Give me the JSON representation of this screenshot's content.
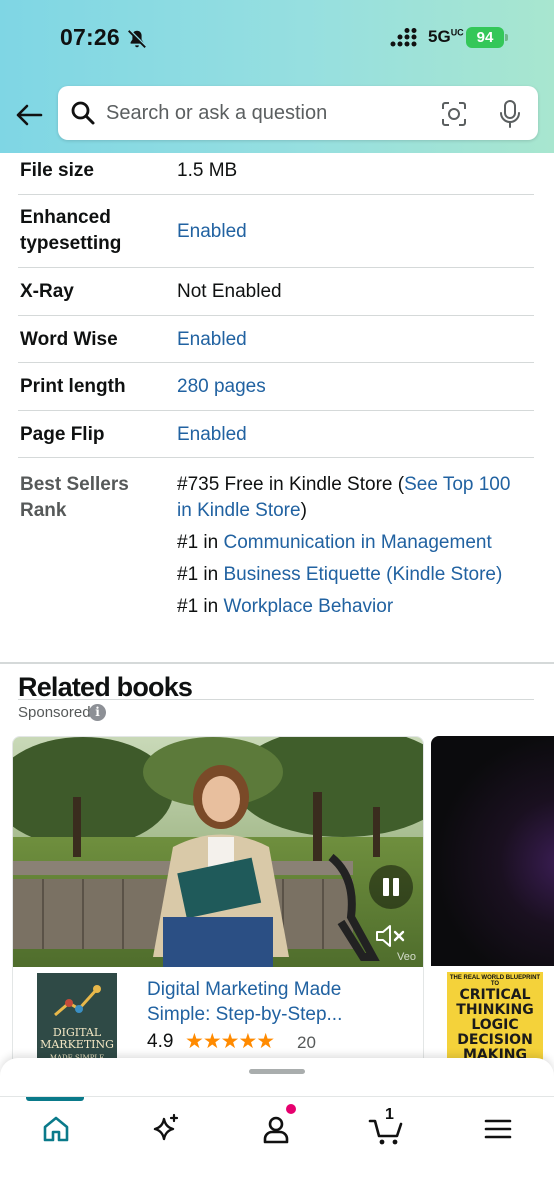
{
  "status_bar": {
    "time": "07:26",
    "network": "5G",
    "network_sup": "UC",
    "battery": "94"
  },
  "search": {
    "placeholder": "Search or ask a question"
  },
  "details": {
    "file_size": {
      "label": "File size",
      "value": "1.5 MB"
    },
    "typesetting": {
      "label": "Enhanced typesetting",
      "value": "Enabled"
    },
    "xray": {
      "label": "X-Ray",
      "value": "Not Enabled"
    },
    "word_wise": {
      "label": "Word Wise",
      "value": "Enabled"
    },
    "print_length": {
      "label": "Print length",
      "value": "280 pages"
    },
    "page_flip": {
      "label": "Page Flip",
      "value": "Enabled"
    },
    "best_sellers": {
      "label": "Best Sellers Rank",
      "line1_prefix": "#735 Free in Kindle Store (",
      "line1_link": "See Top 100 in Kindle Store",
      "line1_suffix": ")",
      "rank2": "#1 in ",
      "rank2_link": "Communication in Management",
      "rank3": "#1 in ",
      "rank3_link": "Business Etiquette (Kindle Store)",
      "rank4": "#1 in ",
      "rank4_link": "Workplace Behavior"
    }
  },
  "related": {
    "title": "Related books",
    "sponsored": "Sponsored",
    "card1": {
      "cover_title": "DIGITAL MARKETING",
      "cover_subtitle": "MADE SIMPLE",
      "video_mark": "Veo",
      "book_title": "Digital Marketing Made Simple: Step-by-Step...",
      "rating": "4.9",
      "stars": "★★★★★",
      "rating_fraction": 0.98,
      "count": "20"
    },
    "card2": {
      "cover_title": "CRITICAL THINKING LOGIC DECISION MAKING",
      "cover_top": "THE REAL WORLD BLUEPRINT TO"
    }
  },
  "tabbar": {
    "cart_count": "1",
    "active_tab": "home"
  },
  "colors": {
    "link": "#2162a1",
    "accent": "#0a7a8a",
    "star": "#ff8a00",
    "badge": "#e6006e"
  }
}
